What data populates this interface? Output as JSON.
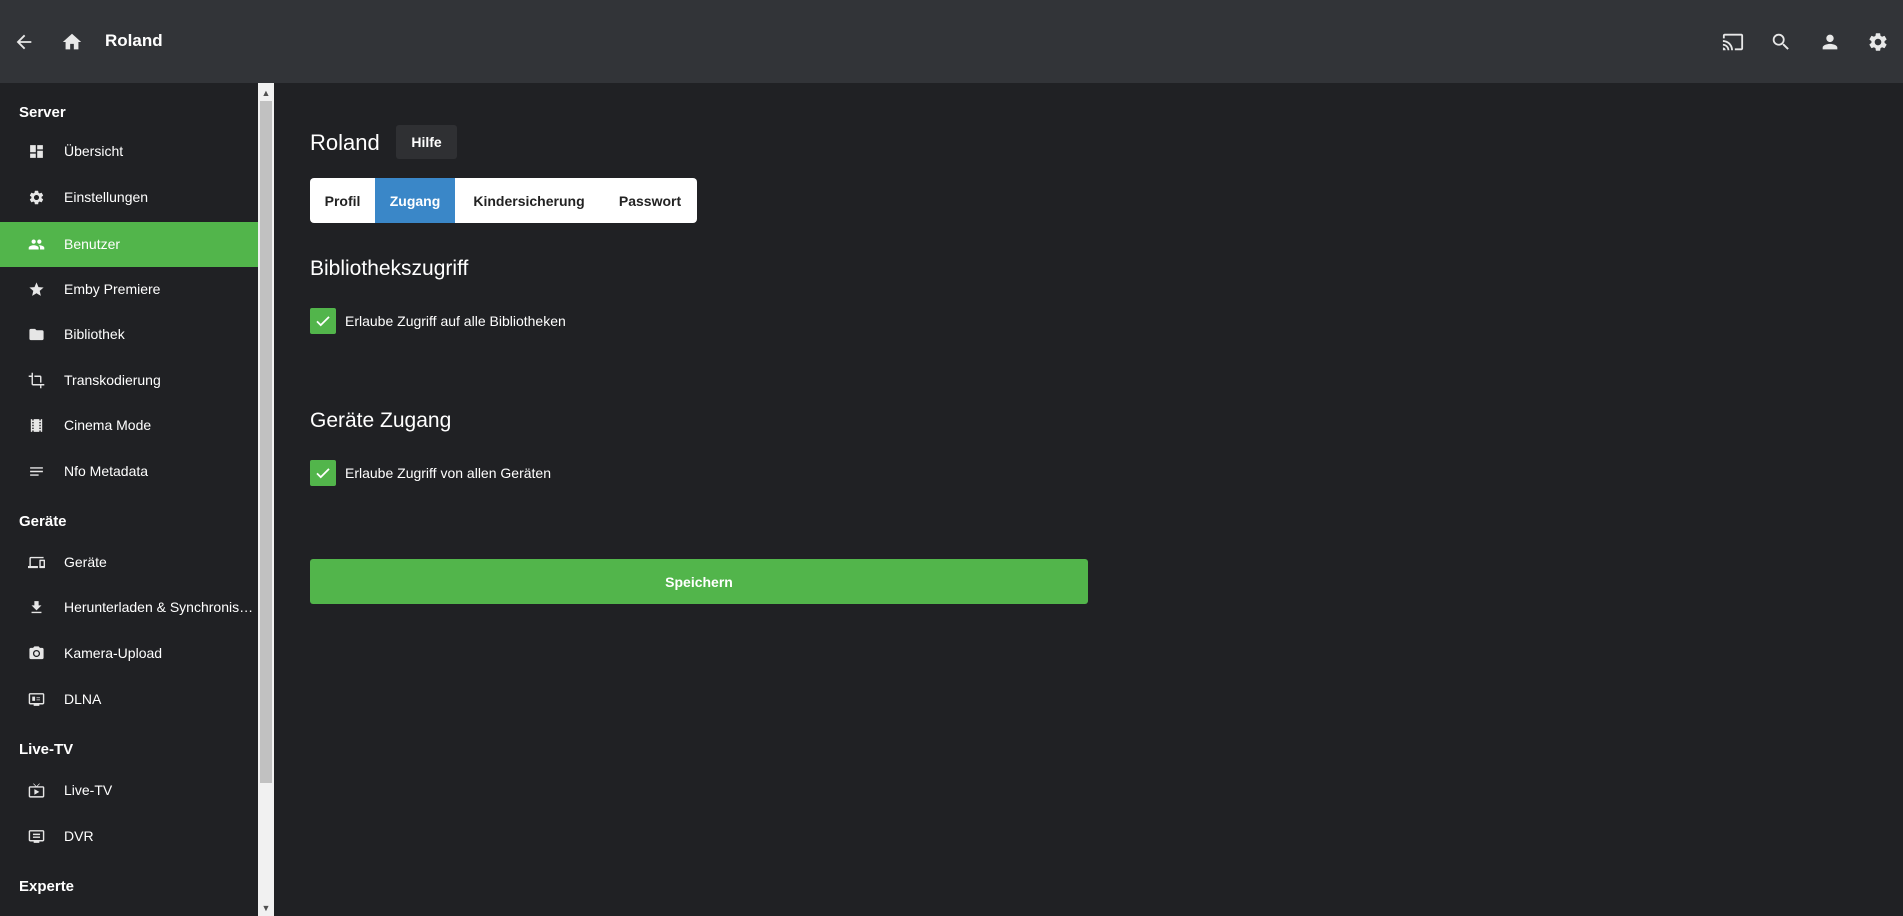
{
  "header": {
    "title": "Roland",
    "icons": [
      "back-arrow-icon",
      "home-icon",
      "cast-icon",
      "search-icon",
      "user-icon",
      "gear-icon"
    ]
  },
  "sidebar": {
    "sections": [
      {
        "title": "Server",
        "items": [
          {
            "label": "Übersicht",
            "icon": "dashboard-icon"
          },
          {
            "label": "Einstellungen",
            "icon": "gear-icon"
          },
          {
            "label": "Benutzer",
            "icon": "people-icon",
            "active": true
          },
          {
            "label": "Emby Premiere",
            "icon": "star-icon"
          },
          {
            "label": "Bibliothek",
            "icon": "folder-icon"
          },
          {
            "label": "Transkodierung",
            "icon": "crop-icon"
          },
          {
            "label": "Cinema Mode",
            "icon": "film-icon"
          },
          {
            "label": "Nfo Metadata",
            "icon": "lines-icon"
          }
        ]
      },
      {
        "title": "Geräte",
        "items": [
          {
            "label": "Geräte",
            "icon": "devices-icon"
          },
          {
            "label": "Herunterladen & Synchronisieren",
            "icon": "download-icon"
          },
          {
            "label": "Kamera-Upload",
            "icon": "camera-icon"
          },
          {
            "label": "DLNA",
            "icon": "dlna-icon"
          }
        ]
      },
      {
        "title": "Live-TV",
        "items": [
          {
            "label": "Live-TV",
            "icon": "live-tv-icon"
          },
          {
            "label": "DVR",
            "icon": "dvr-icon"
          }
        ]
      },
      {
        "title": "Experte",
        "items": []
      }
    ]
  },
  "main": {
    "title": "Roland",
    "help_label": "Hilfe",
    "tabs": [
      {
        "label": "Profil"
      },
      {
        "label": "Zugang",
        "active": true
      },
      {
        "label": "Kindersicherung"
      },
      {
        "label": "Passwort"
      }
    ],
    "library_section": {
      "heading": "Bibliothekszugriff",
      "checkbox_label": "Erlaube Zugriff auf alle Bibliotheken",
      "checked": true
    },
    "device_section": {
      "heading": "Geräte Zugang",
      "checkbox_label": "Erlaube Zugriff von allen Geräten",
      "checked": true
    },
    "save_label": "Speichern"
  },
  "colors": {
    "accent": "#52b54b",
    "tab_active": "#3a87c8",
    "background": "#202124",
    "header": "#323438"
  }
}
